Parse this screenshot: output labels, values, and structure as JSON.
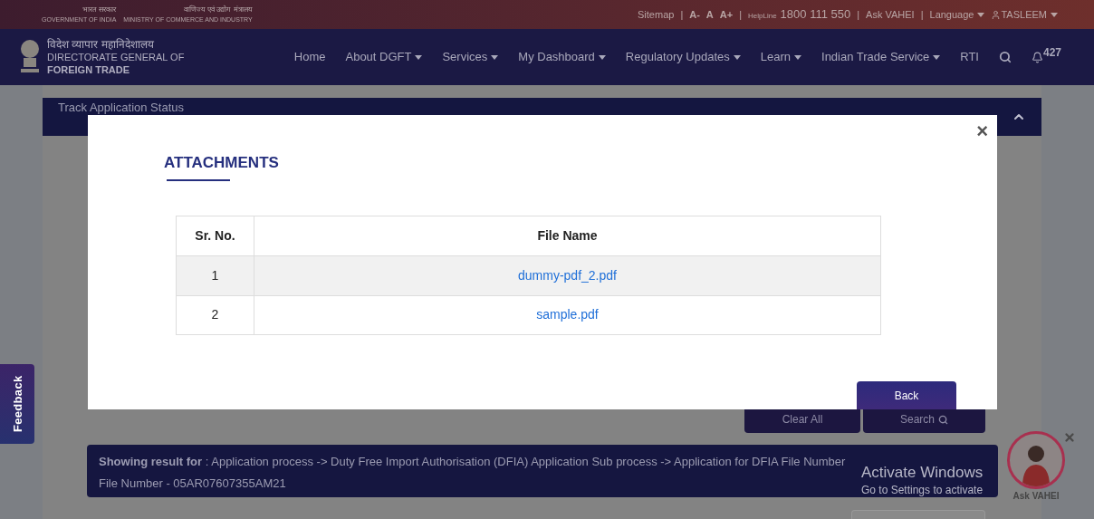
{
  "top_bar": {
    "hindi": [
      "भारत सरकार",
      "वाणिज्य एवं उद्योग मंत्रालय"
    ],
    "english": [
      "GOVERNMENT OF INDIA",
      "MINISTRY OF COMMERCE AND INDUSTRY"
    ],
    "links": [
      {
        "kind": "link",
        "label": "Sitemap"
      },
      {
        "kind": "separator",
        "label": "|"
      },
      {
        "kind": "font",
        "label": "A-"
      },
      {
        "kind": "font",
        "label": "A"
      },
      {
        "kind": "font",
        "label": "A+"
      },
      {
        "kind": "separator",
        "label": "|"
      },
      {
        "kind": "helpline",
        "label": "HelpLine",
        "value": "1800 111 550"
      },
      {
        "kind": "separator",
        "label": "|"
      },
      {
        "kind": "link",
        "label": "Ask VAHEI"
      },
      {
        "kind": "separator",
        "label": "|"
      },
      {
        "kind": "dropdown",
        "label": "Language"
      },
      {
        "kind": "user",
        "label": "TASLEEM"
      }
    ]
  },
  "nav": {
    "logo": {
      "hindi": "विदेश व्यापार महानिदेशालय",
      "line1": "DIRECTORATE GENERAL OF",
      "line2": "FOREIGN TRADE"
    },
    "items": [
      {
        "label": "Home",
        "dropdown": false
      },
      {
        "label": "About DGFT",
        "dropdown": true
      },
      {
        "label": "Services",
        "dropdown": true
      },
      {
        "label": "My Dashboard",
        "dropdown": true
      },
      {
        "label": "Regulatory Updates",
        "dropdown": true
      },
      {
        "label": "Learn",
        "dropdown": true
      },
      {
        "label": "Indian Trade Service",
        "dropdown": true
      },
      {
        "label": "RTI",
        "dropdown": false
      }
    ],
    "notifications": "427"
  },
  "panel": {
    "title": "Track Application Status",
    "expanded": true
  },
  "modal": {
    "title": "ATTACHMENTS",
    "close": "×",
    "columns": [
      "Sr. No.",
      "File Name"
    ],
    "rows": [
      {
        "sr": "1",
        "file": "dummy-pdf_2.pdf"
      },
      {
        "sr": "2",
        "file": "sample.pdf"
      }
    ],
    "button": "Back"
  },
  "actions": [
    "Clear All",
    "Search"
  ],
  "result": "**Showing result for** : Application process -> Duty Free Import Authorisation (DFIA) Application Sub process -> Application for DFIA File Number File Number - 05AR07607355AM21",
  "feedback": "Feedback",
  "assistant": {
    "label": "Ask VAHEI"
  },
  "os_notice": {
    "title": "Activate Windows",
    "text": "Go to Settings to activate"
  }
}
